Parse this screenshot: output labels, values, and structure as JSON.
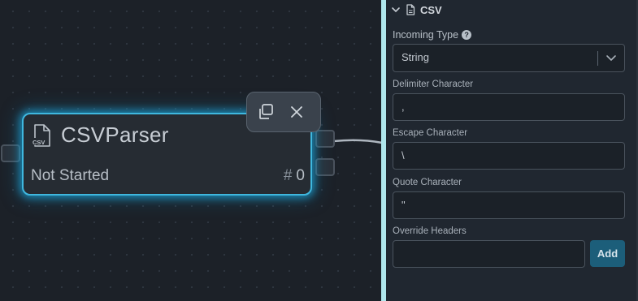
{
  "canvas": {
    "node": {
      "icon": "csv-file-icon",
      "icon_text": "CSV",
      "title": "CSVParser",
      "status": "Not Started",
      "count_prefix": "#",
      "count": "0"
    },
    "toolbar": {
      "copy_icon": "copy-icon",
      "close_icon": "close-icon"
    }
  },
  "panel": {
    "section": {
      "chevron_icon": "chevron-down-icon",
      "file_icon": "file-icon",
      "title": "CSV"
    },
    "fields": {
      "incoming_type": {
        "label": "Incoming Type",
        "help_icon": "help-icon",
        "value": "String"
      },
      "delimiter": {
        "label": "Delimiter Character",
        "value": ","
      },
      "escape": {
        "label": "Escape Character",
        "value": "\\"
      },
      "quote": {
        "label": "Quote Character",
        "value": "\""
      },
      "override_headers": {
        "label": "Override Headers",
        "value": "",
        "add_label": "Add"
      }
    }
  },
  "colors": {
    "node_glow": "#3fb7de",
    "divider": "#aee6ec",
    "add_button": "#1c5e7a",
    "canvas_bg": "#1c2128",
    "panel_bg": "#202730"
  }
}
